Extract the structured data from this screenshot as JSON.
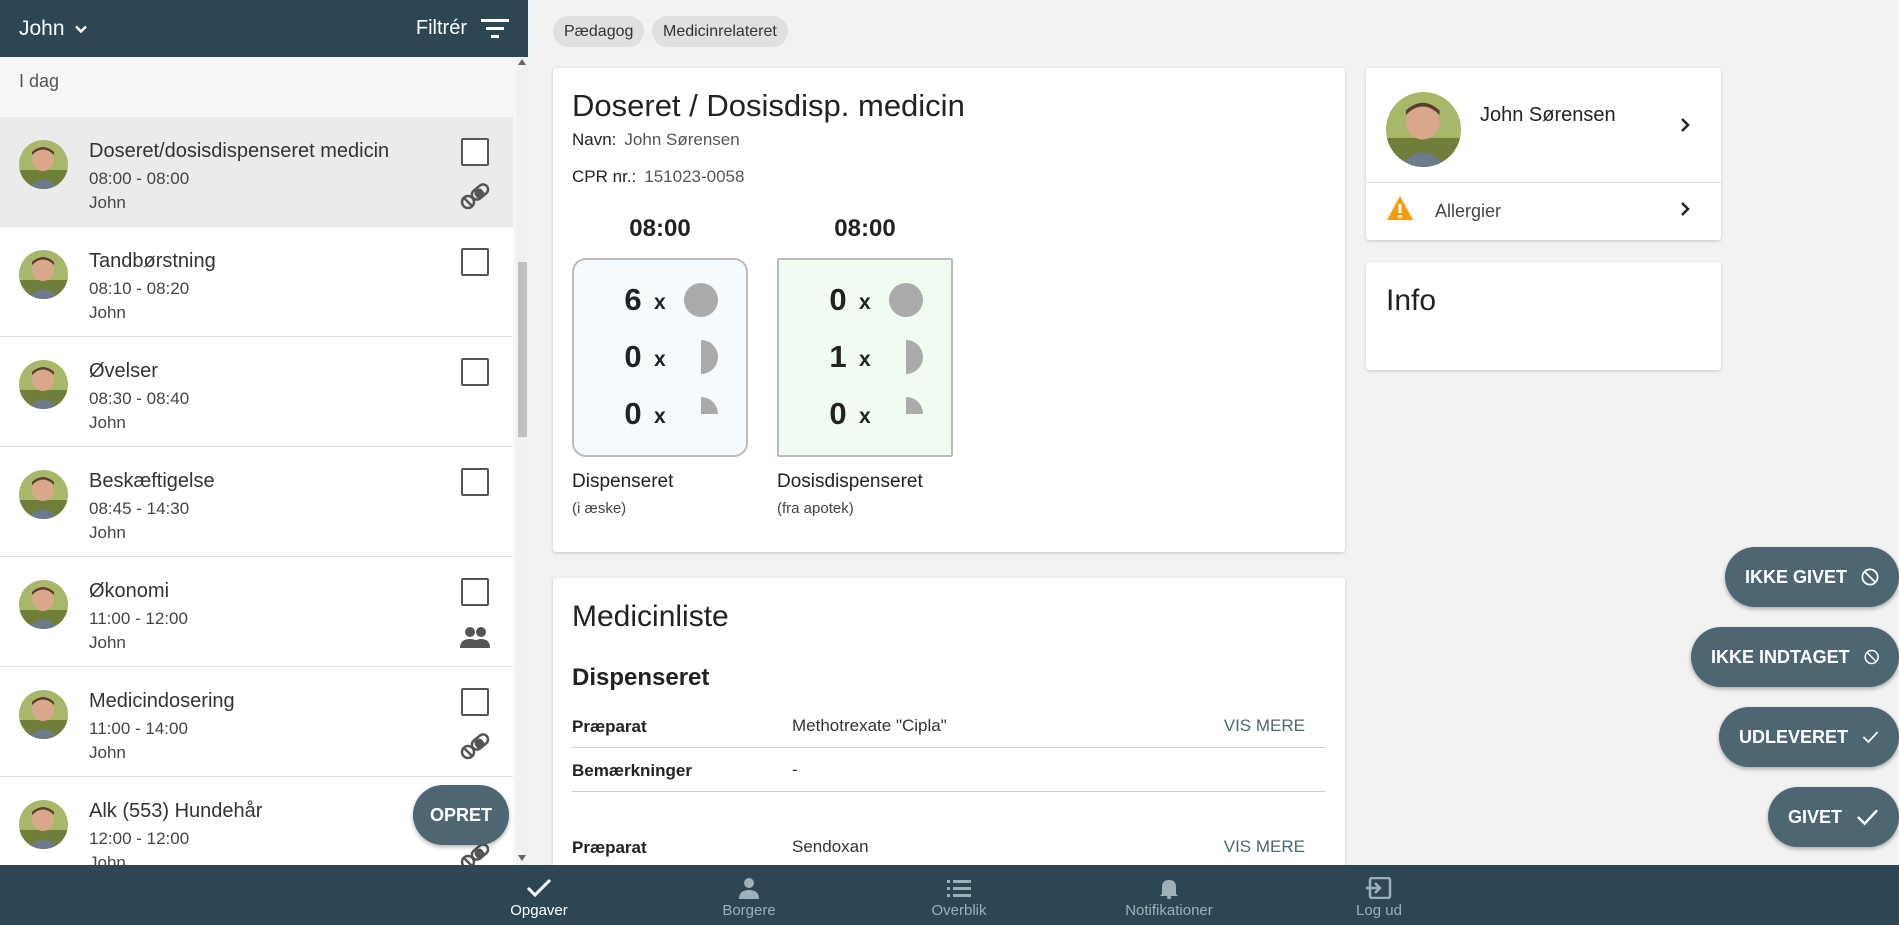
{
  "header": {
    "user": "John",
    "filter_label": "Filtrér"
  },
  "list": {
    "day_label": "I dag",
    "tasks": [
      {
        "title": "Doseret/dosisdispenseret medicin",
        "time": "08:00 - 08:00",
        "who": "John",
        "icon": "pills-icon",
        "selected": true
      },
      {
        "title": "Tandbørstning",
        "time": "08:10 - 08:20",
        "who": "John",
        "icon": ""
      },
      {
        "title": "Øvelser",
        "time": "08:30 - 08:40",
        "who": "John",
        "icon": ""
      },
      {
        "title": "Beskæftigelse",
        "time": "08:45 - 14:30",
        "who": "John",
        "icon": ""
      },
      {
        "title": "Økonomi",
        "time": "11:00 - 12:00",
        "who": "John",
        "icon": "people-icon"
      },
      {
        "title": "Medicindosering",
        "time": "11:00 - 14:00",
        "who": "John",
        "icon": "pills-icon"
      },
      {
        "title": "Alk (553) Hundehår",
        "time": "12:00 - 12:00",
        "who": "John",
        "icon": "pills-icon"
      }
    ],
    "create_button": "OPRET"
  },
  "chips": [
    "Pædagog",
    "Medicinrelateret"
  ],
  "dose_card": {
    "title": "Doseret / Dosisdisp. medicin",
    "name_label": "Navn:",
    "name_value": "John Sørensen",
    "cpr_label": "CPR nr.:",
    "cpr_value": "151023-0058",
    "boxes": [
      {
        "time": "08:00",
        "counts": [
          "6",
          "0",
          "0"
        ],
        "label": "Dispenseret",
        "sub": "(i æske)"
      },
      {
        "time": "08:00",
        "counts": [
          "0",
          "1",
          "0"
        ],
        "label": "Dosisdispenseret",
        "sub": "(fra apotek)"
      }
    ],
    "multiplier": "x"
  },
  "med_list": {
    "title": "Medicinliste",
    "section": "Dispenseret",
    "rows": [
      {
        "key": "Præparat",
        "value": "Methotrexate \"Cipla\"",
        "more": "VIS MERE"
      },
      {
        "key": "Bemærkninger",
        "value": "-",
        "more": ""
      },
      {
        "key": "Præparat",
        "value": "Sendoxan",
        "more": "VIS MERE"
      }
    ]
  },
  "person": {
    "name": "John Sørensen",
    "allergy_label": "Allergier"
  },
  "info": {
    "title": "Info"
  },
  "actions": {
    "not_given": "IKKE GIVET",
    "not_taken": "IKKE INDTAGET",
    "handed_out": "UDLEVERET",
    "given": "GIVET"
  },
  "nav": [
    {
      "label": "Opgaver",
      "icon": "check-icon",
      "active": true
    },
    {
      "label": "Borgere",
      "icon": "person-icon"
    },
    {
      "label": "Overblik",
      "icon": "list-icon"
    },
    {
      "label": "Notifikationer",
      "icon": "bell-icon"
    },
    {
      "label": "Log ud",
      "icon": "logout-icon"
    }
  ],
  "colors": {
    "header": "#2d4654",
    "fab": "#4c6672",
    "warning": "#f39c12"
  }
}
